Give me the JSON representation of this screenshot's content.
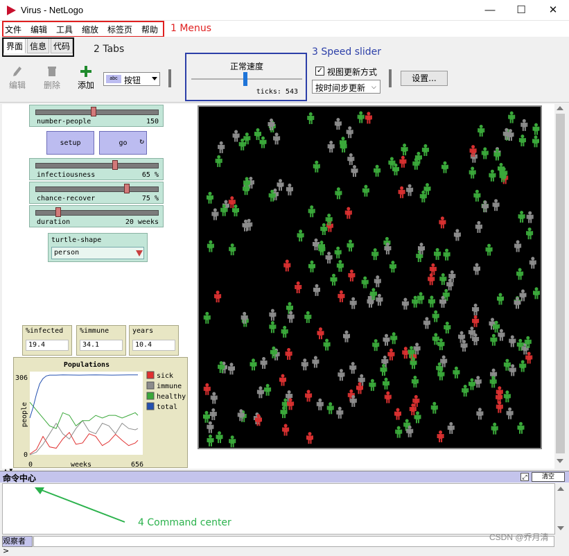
{
  "window": {
    "title": "Virus - NetLogo",
    "min": "—",
    "max": "☐",
    "close": "✕"
  },
  "menus": [
    "文件",
    "编辑",
    "工具",
    "缩放",
    "标签页",
    "帮助"
  ],
  "tabs": [
    "界面",
    "信息",
    "代码"
  ],
  "annotations": {
    "menus": "1 Menus",
    "tabs": "2 Tabs",
    "speed": "3 Speed slider",
    "command": "4 Command center",
    "colors": {
      "red": "#e02020",
      "blue": "#2c3fa8",
      "green": "#2bb24c"
    }
  },
  "toolbar": {
    "edit": "编辑",
    "delete": "删除",
    "add": "添加",
    "widget_type": "按钮",
    "speed_label": "正常速度",
    "ticks_label": "ticks: 543",
    "view_updates_label": "视图更新方式",
    "update_mode": "按时间步更新",
    "settings": "设置..."
  },
  "widgets": {
    "sliders": [
      {
        "name": "number-people",
        "value": "150",
        "fraction": 0.47
      },
      {
        "name": "infectiousness",
        "value": "65 %",
        "fraction": 0.65
      },
      {
        "name": "chance-recover",
        "value": "75 %",
        "fraction": 0.75
      },
      {
        "name": "duration",
        "value": "20 weeks",
        "fraction": 0.17
      }
    ],
    "buttons": {
      "setup": "setup",
      "go": "go"
    },
    "chooser": {
      "label": "turtle-shape",
      "value": "person"
    },
    "monitors": [
      {
        "label": "%infected",
        "value": "19.4"
      },
      {
        "label": "%immune",
        "value": "34.1"
      },
      {
        "label": "years",
        "value": "10.4"
      }
    ]
  },
  "chart_data": {
    "type": "line",
    "title": "Populations",
    "xlabel": "weeks",
    "ylabel": "people",
    "xlim": [
      0,
      656
    ],
    "ylim": [
      0,
      306
    ],
    "x_ticks": [
      "0",
      "656"
    ],
    "y_ticks": [
      "0",
      "306"
    ],
    "legend_position": "right",
    "series": [
      {
        "name": "sick",
        "color": "#e03030",
        "x": [
          0,
          40,
          80,
          120,
          160,
          200,
          240,
          280,
          320,
          360,
          400,
          440,
          480,
          520,
          560,
          600,
          640,
          656
        ],
        "values": [
          3,
          20,
          70,
          30,
          25,
          60,
          85,
          40,
          45,
          80,
          70,
          35,
          50,
          78,
          55,
          35,
          45,
          55
        ]
      },
      {
        "name": "immune",
        "color": "#8c8c8c",
        "x": [
          0,
          40,
          80,
          120,
          160,
          200,
          240,
          280,
          320,
          360,
          400,
          440,
          480,
          520,
          560,
          600,
          640,
          656
        ],
        "values": [
          0,
          10,
          40,
          80,
          120,
          80,
          60,
          100,
          130,
          90,
          80,
          120,
          110,
          80,
          120,
          100,
          95,
          100
        ]
      },
      {
        "name": "healthy",
        "color": "#3aa83a",
        "x": [
          0,
          40,
          80,
          120,
          160,
          200,
          240,
          280,
          320,
          360,
          400,
          440,
          480,
          520,
          560,
          600,
          640,
          656
        ],
        "values": [
          200,
          170,
          140,
          110,
          100,
          160,
          150,
          110,
          130,
          130,
          150,
          140,
          150,
          150,
          140,
          150,
          160,
          150
        ]
      },
      {
        "name": "total",
        "color": "#2350b0",
        "x": [
          0,
          20,
          40,
          60,
          80,
          100,
          120,
          160,
          200,
          300,
          400,
          500,
          600,
          656
        ],
        "values": [
          140,
          180,
          230,
          270,
          290,
          300,
          303,
          303,
          304,
          303,
          304,
          303,
          304,
          304
        ]
      }
    ]
  },
  "command_center": {
    "title": "命令中心",
    "clear": "清空",
    "observer": "观察者>"
  },
  "watermark": "CSDN @乔月清"
}
